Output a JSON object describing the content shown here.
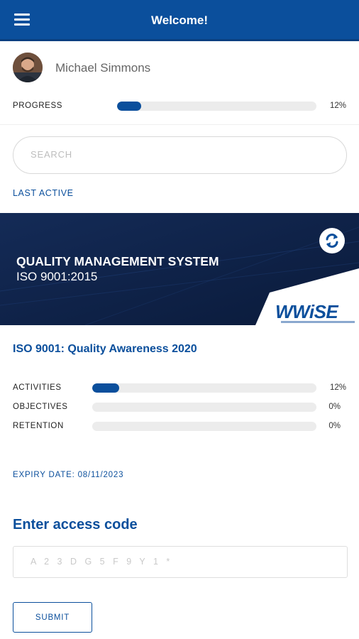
{
  "header": {
    "title": "Welcome!",
    "menu_icon": "hamburger-menu-icon"
  },
  "user": {
    "name": "Michael Simmons",
    "avatar_icon": "user-avatar"
  },
  "progress": {
    "label": "PROGRESS",
    "percent_label": "12%",
    "value": 0.12
  },
  "search": {
    "placeholder": "SEARCH"
  },
  "section": {
    "last_active_label": "LAST ACTIVE"
  },
  "banner": {
    "title": "QUALITY MANAGEMENT SYSTEM",
    "subtitle": "ISO 9001:2015",
    "logo_text": "WWiSE",
    "refresh_icon": "refresh-icon"
  },
  "course": {
    "title": "ISO 9001: Quality Awareness 2020",
    "metrics": [
      {
        "label": "ACTIVITIES",
        "percent_label": "12%",
        "value": 0.12
      },
      {
        "label": "OBJECTIVES",
        "percent_label": "0%",
        "value": 0
      },
      {
        "label": "RETENTION",
        "percent_label": "0%",
        "value": 0
      }
    ],
    "expiry": "EXPIRY DATE: 08/11/2023"
  },
  "access": {
    "title": "Enter access code",
    "placeholder": "A 2 3 D G 5 F 9 Y 1 *",
    "submit_label": "SUBMIT"
  },
  "colors": {
    "primary": "#0b4f9c",
    "banner_bg": "#0c1f43",
    "track": "#ececec"
  }
}
